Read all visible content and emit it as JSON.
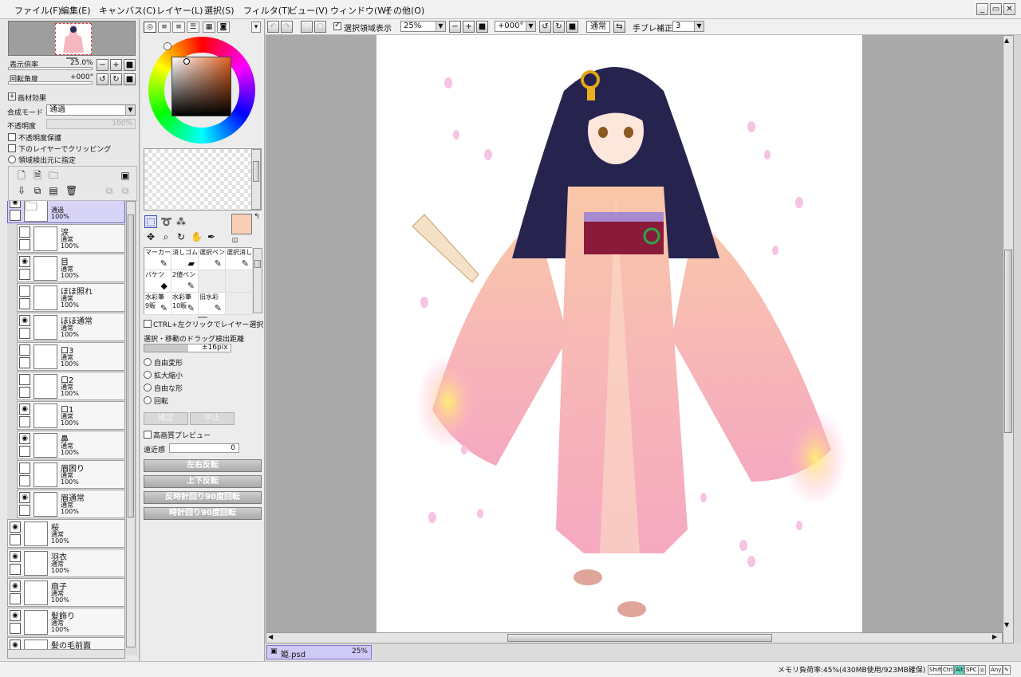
{
  "menu": [
    "ファイル(F)",
    "編集(E)",
    "キャンバス(C)",
    "レイヤー(L)",
    "選択(S)",
    "フィルタ(T)",
    "ビュー(V)",
    "ウィンドウ(W)",
    "その他(O)"
  ],
  "navigator": {
    "zoom_label": "表示倍率",
    "zoom_value": "25.0%",
    "rotate_label": "回転角度",
    "rotate_value": "+000°"
  },
  "layer_props": {
    "paper_effect": "画材効果",
    "blend_label": "合成モード",
    "blend_value": "通過",
    "opacity_label": "不透明度",
    "opacity_value": "100%",
    "protect_opacity": "不透明度保護",
    "clip_below": "下のレイヤーでクリッピング",
    "selection_source": "領域検出元に指定"
  },
  "layers": [
    {
      "name": "",
      "mode": "通過",
      "opacity": "100%",
      "folder": true,
      "selected": true,
      "visible": true
    },
    {
      "name": "涙",
      "mode": "通常",
      "opacity": "100%",
      "visible": false,
      "nested": true
    },
    {
      "name": "目",
      "mode": "通常",
      "opacity": "100%",
      "visible": true,
      "nested": true
    },
    {
      "name": "ほほ照れ",
      "mode": "通常",
      "opacity": "100%",
      "visible": false,
      "nested": true
    },
    {
      "name": "ほほ通常",
      "mode": "通常",
      "opacity": "100%",
      "visible": true,
      "nested": true
    },
    {
      "name": "口3",
      "mode": "通常",
      "opacity": "100%",
      "visible": false,
      "nested": true
    },
    {
      "name": "口2",
      "mode": "通常",
      "opacity": "100%",
      "visible": false,
      "nested": true
    },
    {
      "name": "口1",
      "mode": "通常",
      "opacity": "100%",
      "visible": true,
      "nested": true
    },
    {
      "name": "鼻",
      "mode": "通常",
      "opacity": "100%",
      "visible": true,
      "nested": true
    },
    {
      "name": "眉困り",
      "mode": "通常",
      "opacity": "100%",
      "visible": false,
      "nested": true
    },
    {
      "name": "眉通常",
      "mode": "通常",
      "opacity": "100%",
      "visible": true,
      "nested": true
    },
    {
      "name": "桜",
      "mode": "通常",
      "opacity": "100%",
      "visible": true
    },
    {
      "name": "羽衣",
      "mode": "通常",
      "opacity": "100%",
      "visible": true
    },
    {
      "name": "扇子",
      "mode": "通常",
      "opacity": "100%",
      "visible": true
    },
    {
      "name": "髪飾り",
      "mode": "通常",
      "opacity": "100%",
      "visible": true
    },
    {
      "name": "髪の毛前面",
      "mode": "通常",
      "opacity": "100%",
      "visible": true
    }
  ],
  "brushes": [
    {
      "name": "マーカー",
      "icon": "✎"
    },
    {
      "name": "消しゴム",
      "icon": "▰"
    },
    {
      "name": "選択ペン",
      "icon": "✎"
    },
    {
      "name": "選択消し",
      "icon": "✎"
    },
    {
      "name": "バケツ",
      "icon": "◆"
    },
    {
      "name": "2値ペン",
      "icon": "✎"
    },
    {
      "name": "",
      "icon": ""
    },
    {
      "name": "",
      "icon": ""
    },
    {
      "name": "水彩筆\n9販",
      "icon": "✎"
    },
    {
      "name": "水彩筆\n10販",
      "icon": "✎"
    },
    {
      "name": "旧水彩",
      "icon": "✎"
    },
    {
      "name": "",
      "icon": ""
    }
  ],
  "tool_options": {
    "ctrl_click": "CTRL+左クリックでレイヤー選択",
    "drag_label": "選択・移動のドラッグ検出距離",
    "drag_value": "±16pix",
    "free_transform": "自由変形",
    "scale": "拡大縮小",
    "distort": "自由な形",
    "rotate": "回転",
    "ok": "確定",
    "cancel": "中止",
    "hq_preview": "高画質プレビュー",
    "perspective_label": "遠近感",
    "perspective_value": "0",
    "flip_h": "左右反転",
    "flip_v": "上下反転",
    "rot_ccw": "反時計回り90度回転",
    "rot_cw": "時計回り90度回転"
  },
  "canvas_toolbar": {
    "show_selection": "選択領域表示",
    "zoom": "25%",
    "angle": "+000°",
    "mode": "通常",
    "stabilizer_label": "手ブレ補正",
    "stabilizer_value": "3"
  },
  "document": {
    "tab_name": "姫.psd",
    "tab_zoom": "25%"
  },
  "status": {
    "memory": "メモリ負荷率:45%(430MB使用/923MB確保)",
    "keys": [
      "Shift",
      "Ctrl",
      "Alt",
      "SPC",
      "◎",
      "Any",
      "✎"
    ],
    "active_key": "Alt"
  },
  "colors": {
    "primary": "#f8d0b8",
    "secondary": "#ffffff",
    "selection_accent": "#6a62c8"
  }
}
